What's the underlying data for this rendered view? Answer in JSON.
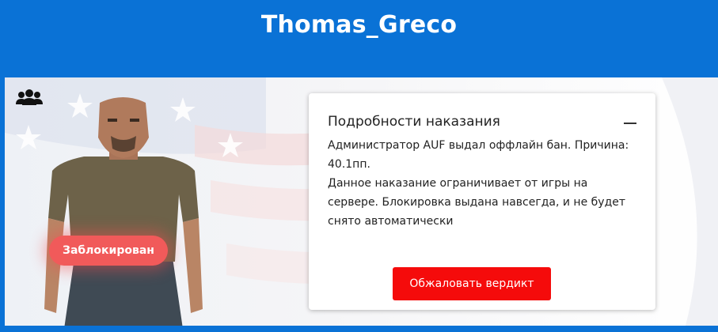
{
  "header": {
    "title": "Thomas_Greco"
  },
  "profile": {
    "status_badge": "Заблокирован",
    "group_icon": "users-group-icon"
  },
  "punishment_card": {
    "title": "Подробности наказания",
    "collapse_icon": "minus-icon",
    "paragraph_1": "Администратор AUF выдал оффлайн бан. Причина: 40.1пп.",
    "paragraph_2": "Данное наказание ограничивает от игры на сервере. Блокировка выдана навсегда, и не будет снято автоматически",
    "appeal_button": "Обжаловать вердикт"
  },
  "colors": {
    "header_bg": "#0a72d6",
    "badge_bg": "#f15a5a",
    "button_bg": "#f50b0b"
  }
}
